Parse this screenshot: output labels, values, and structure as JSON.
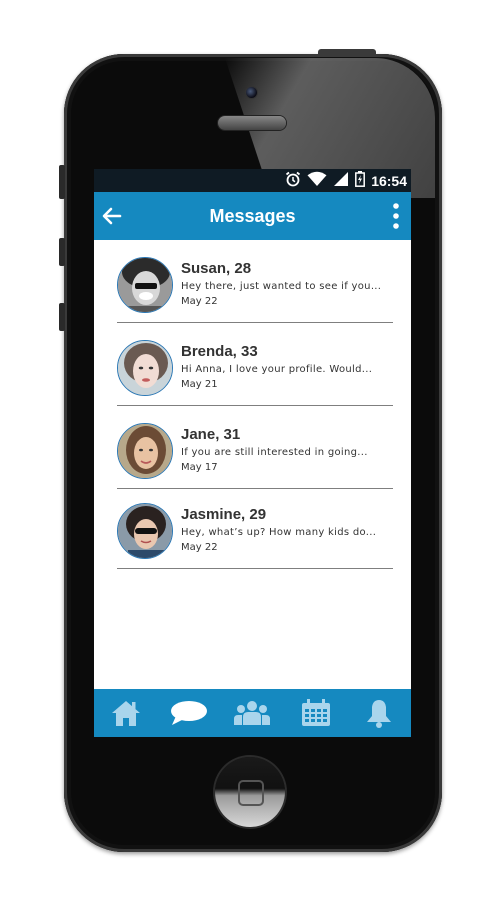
{
  "colors": {
    "accent": "#1589c0",
    "tab_icon": "#a9d5ec",
    "status_bar": "#0f1b24"
  },
  "status_bar": {
    "time": "16:54",
    "icons": [
      "alarm-icon",
      "wifi-icon",
      "signal-icon",
      "battery-icon"
    ]
  },
  "app_bar": {
    "title": "Messages",
    "back_icon": "arrow-left-icon",
    "menu_icon": "more-vert-icon"
  },
  "messages": [
    {
      "name": "Susan, 28",
      "preview": "Hey there, just wanted to see if you...",
      "date": "May 22"
    },
    {
      "name": "Brenda, 33",
      "preview": "Hi Anna, I love your profile.  Would...",
      "date": "May 21"
    },
    {
      "name": "Jane, 31",
      "preview": "If you are still interested in going...",
      "date": "May 17"
    },
    {
      "name": "Jasmine, 29",
      "preview": "Hey, what’s up?  How many kids do...",
      "date": "May 22"
    }
  ],
  "tab_bar": {
    "tabs": [
      "home-icon",
      "chat-icon",
      "people-icon",
      "calendar-icon",
      "bell-icon"
    ]
  }
}
